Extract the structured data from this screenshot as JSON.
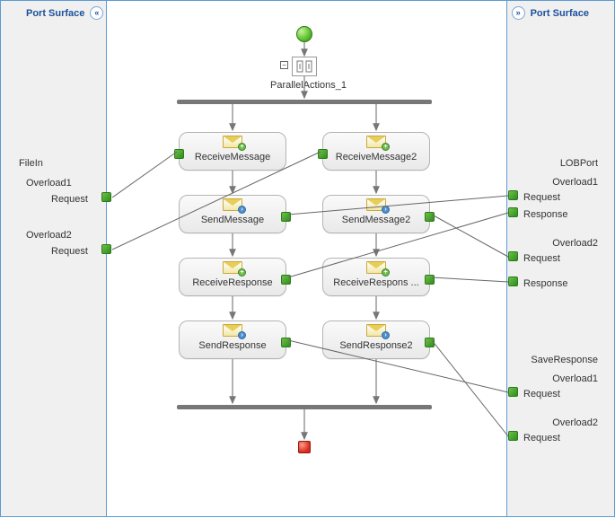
{
  "leftPanel": {
    "title": "Port Surface",
    "chevron": "«",
    "port1": {
      "name": "FileIn",
      "op1": {
        "name": "Overload1",
        "msg": "Request"
      },
      "op2": {
        "name": "Overload2",
        "msg": "Request"
      }
    }
  },
  "rightPanel": {
    "title": "Port Surface",
    "chevron": "»",
    "port1": {
      "name": "LOBPort",
      "op1": {
        "name": "Overload1",
        "req": "Request",
        "res": "Response"
      },
      "op2": {
        "name": "Overload2",
        "req": "Request",
        "res": "Response"
      }
    },
    "port2": {
      "name": "SaveResponse",
      "op1": {
        "name": "Overload1",
        "msg": "Request"
      },
      "op2": {
        "name": "Overload2",
        "msg": "Request"
      }
    }
  },
  "orchestration": {
    "parallel_label": "ParallelActions_1",
    "branch1": {
      "recv": "ReceiveMessage",
      "send": "SendMessage",
      "recvResp": "ReceiveResponse",
      "sendResp": "SendResponse"
    },
    "branch2": {
      "recv": "ReceiveMessage2",
      "send": "SendMessage2",
      "recvResp": "ReceiveRespons ...",
      "sendResp": "SendResponse2"
    }
  }
}
